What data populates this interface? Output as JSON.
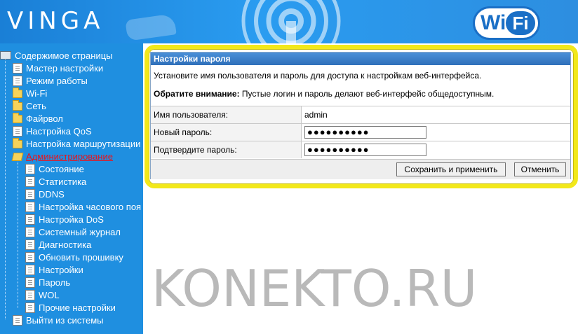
{
  "header": {
    "logo": "VINGA",
    "wifi_badge_w": "Wi",
    "wifi_badge_fi": "Fi"
  },
  "sidebar": {
    "root": "Содержимое страницы",
    "items": [
      {
        "label": "Мастер настройки",
        "icon": "document-icon"
      },
      {
        "label": "Режим работы",
        "icon": "document-icon"
      },
      {
        "label": "Wi-Fi",
        "icon": "folder-icon"
      },
      {
        "label": "Сеть",
        "icon": "folder-icon"
      },
      {
        "label": "Файрвол",
        "icon": "folder-icon"
      },
      {
        "label": "Настройка QoS",
        "icon": "document-icon"
      },
      {
        "label": "Настройка маршрутизации",
        "icon": "folder-icon"
      },
      {
        "label": "Администрирование",
        "icon": "folder-open-icon",
        "active": true
      }
    ],
    "admin_children": [
      "Состояние",
      "Статистика",
      "DDNS",
      "Настройка часового поя",
      "Настройка DoS",
      "Системный журнал",
      "Диагностика",
      "Обновить прошивку",
      "Настройки",
      "Пароль",
      "WOL",
      "Прочие настройки"
    ],
    "logout": "Выйти из системы",
    "active_color": "#e8141c"
  },
  "panel": {
    "title": "Настройки пароля",
    "intro": "Установите имя пользователя и пароль для доступа к настройкам веб-интерфейса.",
    "note_bold": "Обратите внимание:",
    "note_text": " Пустые логин и пароль делают веб-интерфейс общедоступным.",
    "username_label": "Имя пользователя:",
    "username_value": "admin",
    "new_password_label": "Новый пароль:",
    "new_password_value": "●●●●●●●●●●",
    "confirm_password_label": "Подтвердите пароль:",
    "confirm_password_value": "●●●●●●●●●●",
    "save_button": "Сохранить и применить",
    "cancel_button": "Отменить",
    "highlight_color": "#f2e81a"
  },
  "watermark": "KONEKTO.RU"
}
